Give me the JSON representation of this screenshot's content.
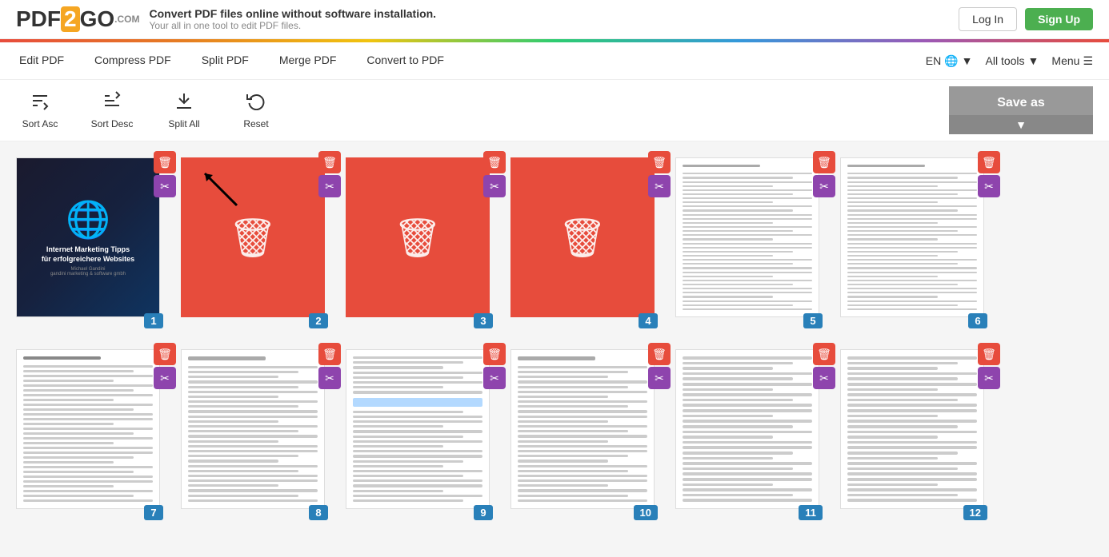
{
  "logo": {
    "text_pdf": "PDF",
    "text_two": "2",
    "text_go": "GO",
    "text_com": ".COM"
  },
  "tagline": {
    "main": "Convert PDF files online without software installation.",
    "sub": "Your all in one tool to edit PDF files."
  },
  "header": {
    "login_label": "Log In",
    "signup_label": "Sign Up"
  },
  "nav": {
    "links": [
      {
        "label": "Edit PDF",
        "id": "edit-pdf"
      },
      {
        "label": "Compress PDF",
        "id": "compress-pdf"
      },
      {
        "label": "Split PDF",
        "id": "split-pdf"
      },
      {
        "label": "Merge PDF",
        "id": "merge-pdf"
      },
      {
        "label": "Convert to PDF",
        "id": "convert-to-pdf"
      }
    ],
    "lang": "EN",
    "all_tools": "All tools",
    "menu": "Menu"
  },
  "toolbar": {
    "sort_asc_label": "Sort Asc",
    "sort_desc_label": "Sort Desc",
    "split_all_label": "Split All",
    "reset_label": "Reset",
    "save_as_label": "Save as"
  },
  "pages_row1": [
    {
      "num": 1,
      "type": "cover",
      "deleted": false
    },
    {
      "num": 2,
      "type": "deleted",
      "deleted": true
    },
    {
      "num": 3,
      "type": "deleted",
      "deleted": true
    },
    {
      "num": 4,
      "type": "deleted",
      "deleted": true
    },
    {
      "num": 5,
      "type": "text",
      "deleted": false
    },
    {
      "num": 6,
      "type": "text",
      "deleted": false
    }
  ],
  "pages_row2": [
    {
      "num": 7,
      "type": "text",
      "deleted": false
    },
    {
      "num": 8,
      "type": "text",
      "deleted": false
    },
    {
      "num": 9,
      "type": "text_highlight",
      "deleted": false
    },
    {
      "num": 10,
      "type": "text",
      "deleted": false
    },
    {
      "num": 11,
      "type": "text",
      "deleted": false
    },
    {
      "num": 12,
      "type": "text",
      "deleted": false
    }
  ],
  "icons": {
    "sort_asc": "⇅",
    "sort_desc": "⇅",
    "split": "✂",
    "reset": "↺",
    "trash": "🗑",
    "scissors": "✂",
    "chevron_down": "▼",
    "globe": "🌐"
  },
  "colors": {
    "green": "#4caf50",
    "red": "#e74c3c",
    "purple": "#8e44ad",
    "blue": "#2980b9",
    "gray": "#999999"
  }
}
